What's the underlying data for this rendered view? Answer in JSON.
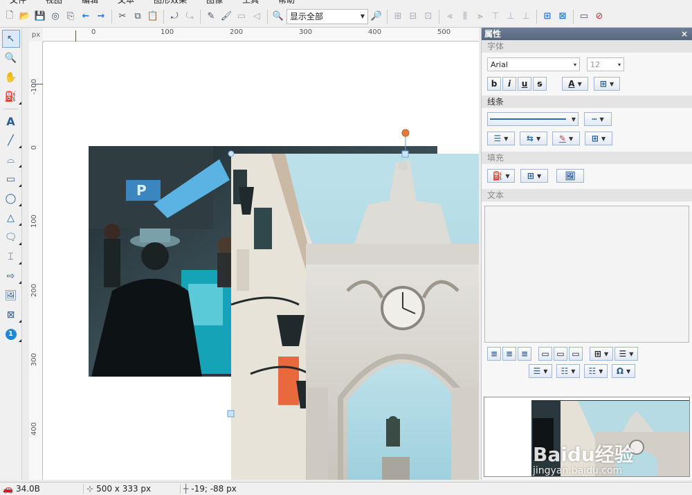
{
  "menubar": [
    "文件",
    "视图",
    "编辑",
    "文本",
    "图形效果",
    "图像",
    "工具",
    "帮助"
  ],
  "toolbar": {
    "zoom_value": "显示全部"
  },
  "ruler": {
    "unit": "px",
    "top_marks": [
      "0",
      "100",
      "200",
      "300",
      "400",
      "500"
    ],
    "left_marks": [
      "-100",
      "0",
      "100",
      "200",
      "300",
      "400"
    ]
  },
  "panel": {
    "title": "属性",
    "close": "×",
    "font_section": "字体",
    "font_name": "Arial",
    "font_size": "12",
    "bold": "b",
    "italic": "i",
    "underline": "u",
    "strike": "s",
    "font_color_glyph": "A",
    "line_section": "线条",
    "fill_section": "填充",
    "text_section": "文本"
  },
  "status": {
    "size_kb": "34.0B",
    "dimensions": "500 x 333 px",
    "coords": "-19; -88 px"
  },
  "watermark": {
    "brand": "Baidu经验",
    "url": "jingyan.baidu.com"
  },
  "colors": {
    "accent": "#2a7ad6",
    "panel_title": "#5e6e86",
    "handle_orange": "#e07b39",
    "handle_blue": "#6aa0d8"
  }
}
